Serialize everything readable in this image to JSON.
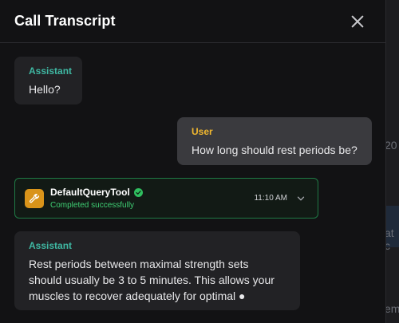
{
  "background": {
    "snippet_1": "20",
    "snippet_2": "at c",
    "snippet_3": "em"
  },
  "panel": {
    "title": "Call Transcript"
  },
  "messages": [
    {
      "role": "Assistant",
      "text": "Hello?"
    },
    {
      "role": "User",
      "text": "How long should rest periods be?"
    },
    {
      "role": "Assistant",
      "text": "Rest periods between maximal strength sets should usually be 3 to 5 minutes. This allows your muscles to recover adequately for optimal ●"
    }
  ],
  "tool_call": {
    "name": "DefaultQueryTool",
    "status": "Completed successfully",
    "time": "11:10 AM",
    "icon": "wrench-icon"
  },
  "colors": {
    "assistant_role": "#3fb8a3",
    "user_role": "#f0b72f",
    "tool_border": "#1f7a45",
    "tool_icon_bg": "#d9941a",
    "success": "#3fcf74"
  }
}
